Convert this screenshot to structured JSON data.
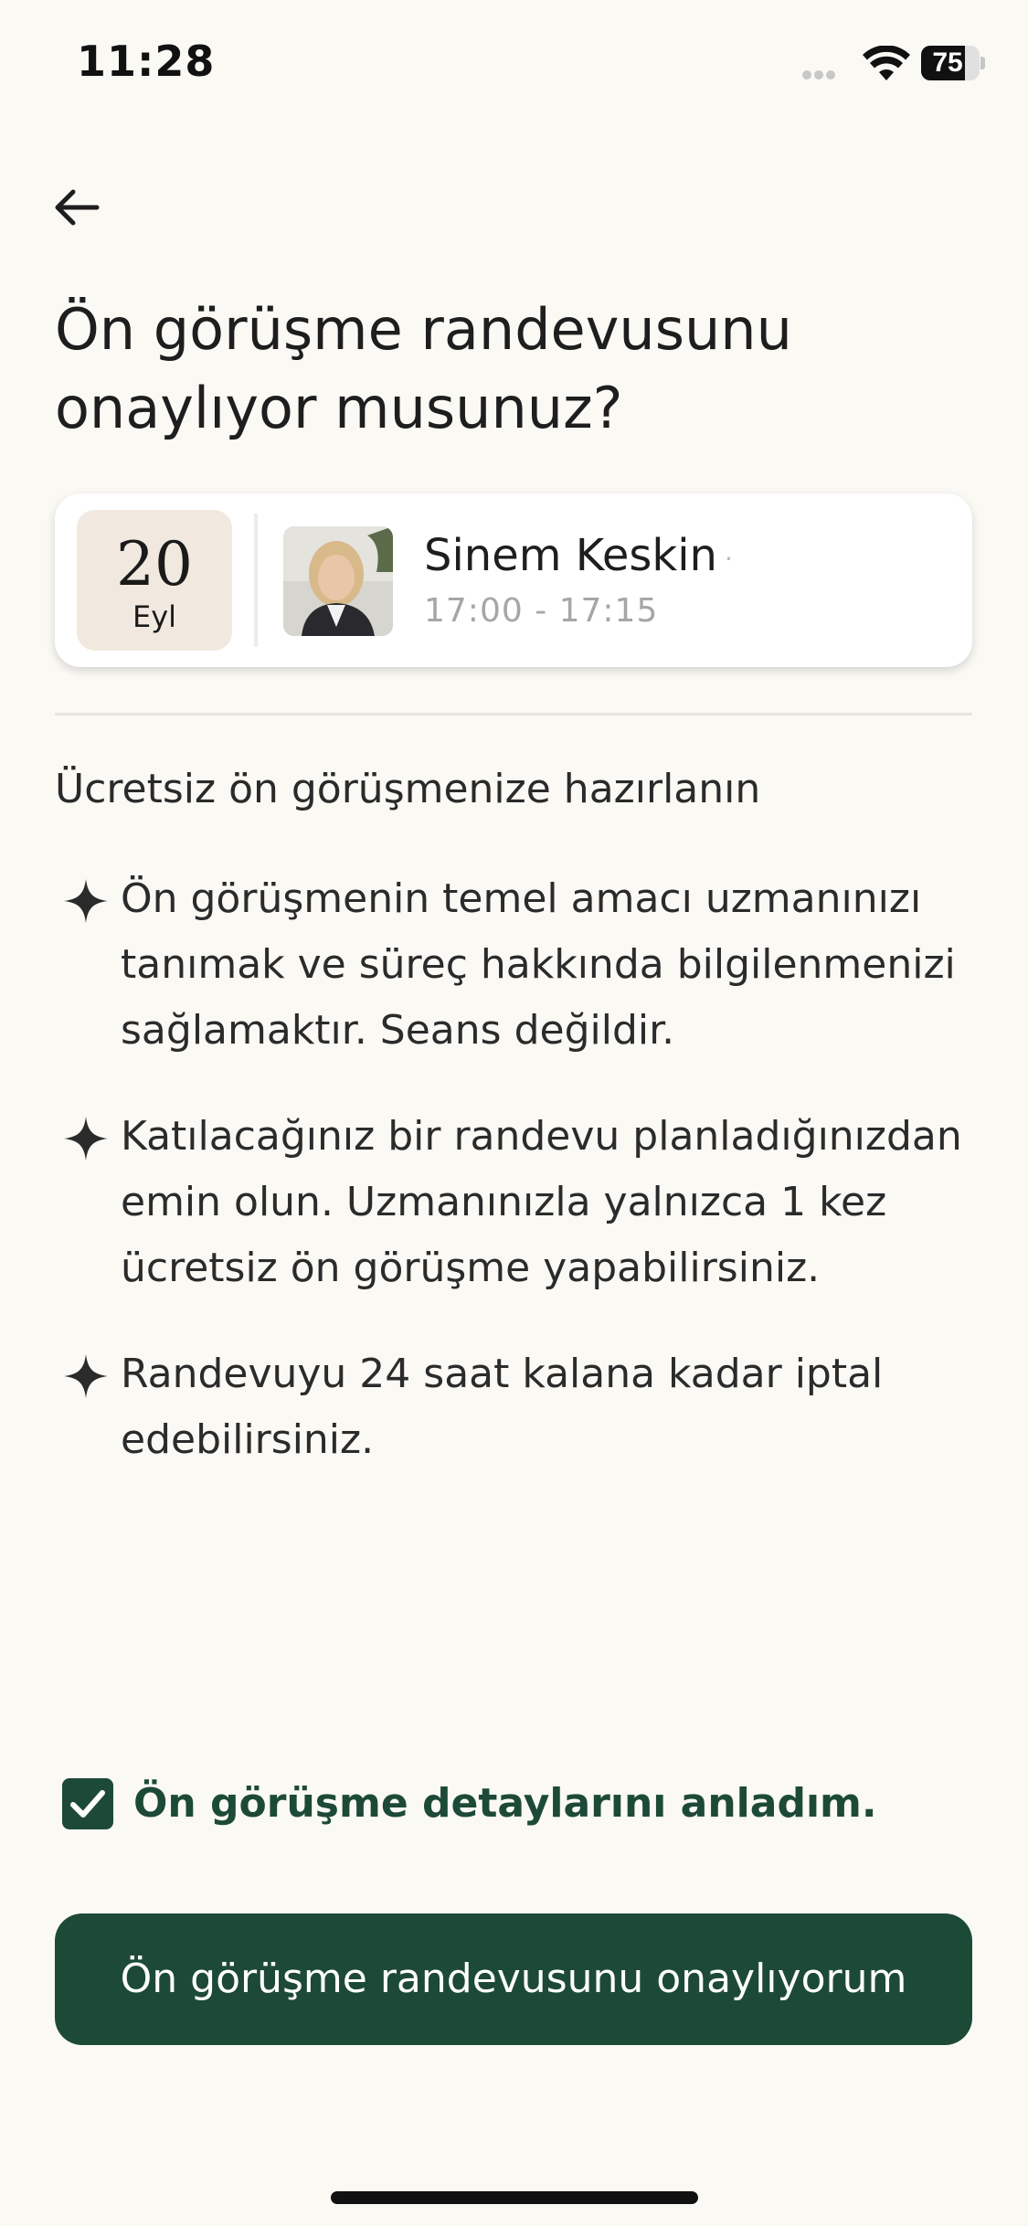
{
  "status_bar": {
    "time": "11:28",
    "battery_percent": "75",
    "battery_level": 0.75
  },
  "header": {
    "title": "Ön görüşme randevusunu onaylıyor musunuz?"
  },
  "appointment": {
    "day": "20",
    "month": "Eyl",
    "expert_name": "Sinem Keskin",
    "time_range": "17:00 - 17:15"
  },
  "info": {
    "heading": "Ücretsiz ön görüşmenize hazırlanın",
    "items": [
      {
        "text": "Ön görüşmenin temel amacı uzmanınızı tanımak ve süreç hakkında bilgilenmenizi sağlamaktır. Seans değildir."
      },
      {
        "text": "Katılacağınız bir randevu planladığınızdan emin olun. Uzmanınızla yalnızca 1 kez ücretsiz ön görüşme yapabilirsiniz."
      },
      {
        "text": "Randevuyu 24 saat kalana kadar iptal edebilirsiniz."
      }
    ]
  },
  "agreement": {
    "checked": true,
    "label": "Ön görüşme detaylarını anladım."
  },
  "actions": {
    "confirm_label": "Ön görüşme randevusunu onaylıyorum"
  },
  "colors": {
    "primary": "#1d4a37",
    "background": "#faf9f4",
    "date_box": "#f1e9df",
    "muted_text": "#a6a6a6"
  },
  "icons": {
    "back": "arrow-left-icon",
    "bullet": "sparkle-icon",
    "checkbox": "check-icon",
    "wifi": "wifi-icon"
  }
}
